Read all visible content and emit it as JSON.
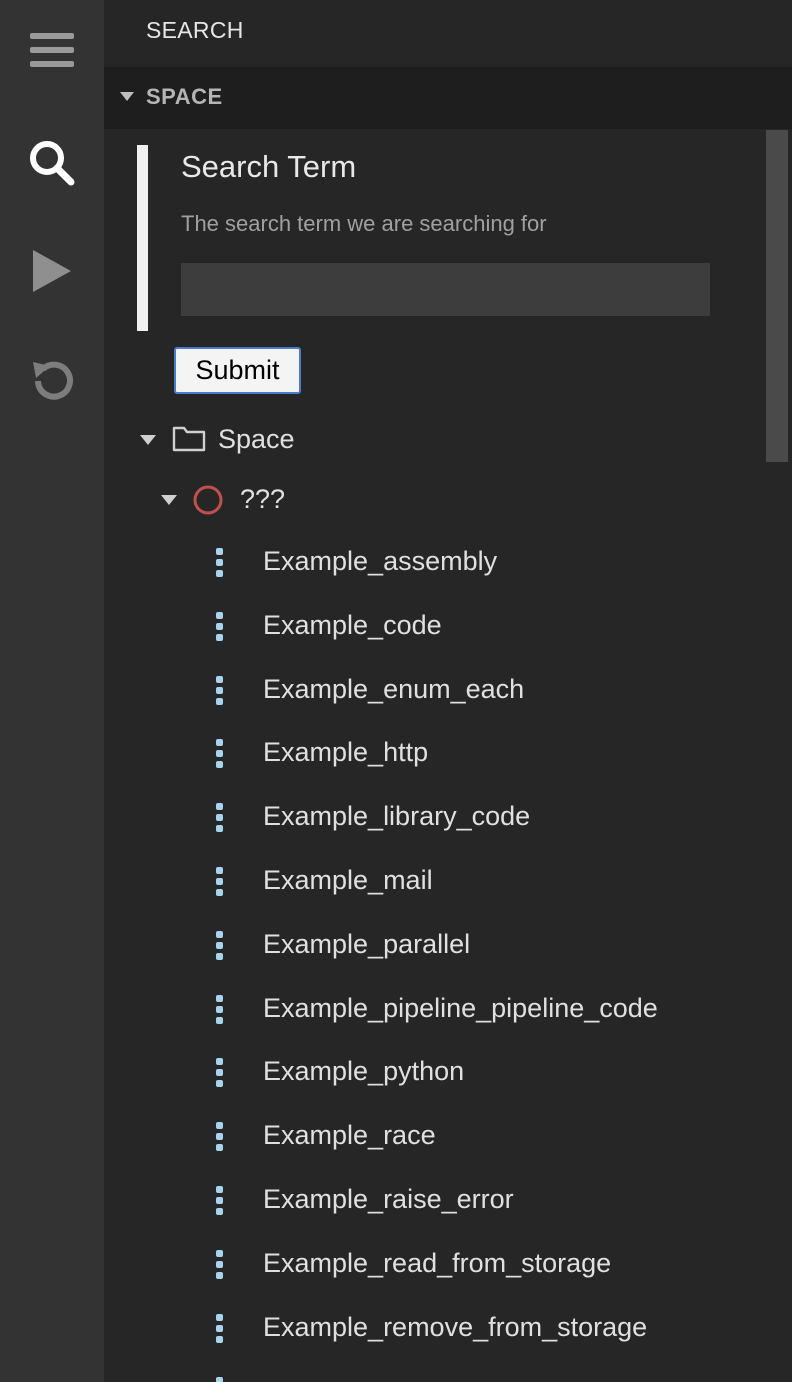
{
  "activity_bar": {
    "icons": [
      "menu-icon",
      "search-icon",
      "run-icon",
      "undo-icon"
    ]
  },
  "sidebar": {
    "title": "SEARCH",
    "section": "SPACE"
  },
  "form": {
    "field_title": "Search Term",
    "field_description": "The search term we are searching for",
    "input_value": "",
    "submit_label": "Submit"
  },
  "tree": {
    "root_label": "Space",
    "group_label": "???",
    "items": [
      "Example_assembly",
      "Example_code",
      "Example_enum_each",
      "Example_http",
      "Example_library_code",
      "Example_mail",
      "Example_parallel",
      "Example_pipeline_pipeline_code",
      "Example_python",
      "Example_race",
      "Example_raise_error",
      "Example_read_from_storage",
      "Example_remove_from_storage"
    ]
  },
  "colors": {
    "activity_bar": "#333333",
    "sidebar": "#262626",
    "accent_item_icon": "#a9d4ee",
    "status_circle": "#c0504d"
  }
}
